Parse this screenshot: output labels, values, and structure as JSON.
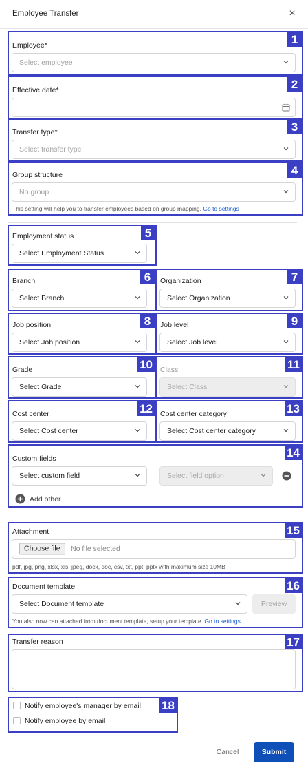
{
  "header": {
    "title": "Employee Transfer",
    "close_symbol": "×"
  },
  "badges": [
    "1",
    "2",
    "3",
    "4",
    "5",
    "6",
    "7",
    "8",
    "9",
    "10",
    "11",
    "12",
    "13",
    "14",
    "15",
    "16",
    "17",
    "18"
  ],
  "employee": {
    "label": "Employee*",
    "placeholder": "Select employee"
  },
  "effective_date": {
    "label": "Effective date*",
    "value": ""
  },
  "transfer_type": {
    "label": "Transfer type*",
    "placeholder": "Select transfer type"
  },
  "group_structure": {
    "label": "Group structure",
    "value": "No group",
    "help": "This setting will help you to transfer employees based on group mapping.",
    "link": "Go to settings"
  },
  "employment_status": {
    "label": "Employment status",
    "value": "Select Employment Status"
  },
  "branch": {
    "label": "Branch",
    "value": "Select Branch"
  },
  "organization": {
    "label": "Organization",
    "value": "Select Organization"
  },
  "job_position": {
    "label": "Job position",
    "value": "Select Job position"
  },
  "job_level": {
    "label": "Job level",
    "value": "Select Job level"
  },
  "grade": {
    "label": "Grade",
    "value": "Select Grade"
  },
  "class": {
    "label": "Class",
    "value": "Select Class"
  },
  "cost_center": {
    "label": "Cost center",
    "value": "Select Cost center"
  },
  "cost_center_category": {
    "label": "Cost center category",
    "value": "Select Cost center category"
  },
  "custom_fields": {
    "label": "Custom fields",
    "field_value": "Select custom field",
    "option_value": "Select field option",
    "add_label": "Add other"
  },
  "attachment": {
    "label": "Attachment",
    "button": "Choose file",
    "status": "No file selected",
    "help": "pdf, jpg, png, xlsx, xls, jpeg, docx, doc, csv, txt, ppt, pptx with maximum size 10MB"
  },
  "document_template": {
    "label": "Document template",
    "value": "Select Document template",
    "preview": "Preview",
    "help": "You also now can attached from document template, setup your template.",
    "link": "Go to settings"
  },
  "transfer_reason": {
    "label": "Transfer reason",
    "value": ""
  },
  "notify": {
    "manager_label": "Notify employee's manager by email",
    "employee_label": "Notify employee by email"
  },
  "footer": {
    "cancel": "Cancel",
    "submit": "Submit"
  },
  "colors": {
    "annotation": "#3b3fc4",
    "primary": "#0e4fb8",
    "link": "#1a5bd6"
  }
}
